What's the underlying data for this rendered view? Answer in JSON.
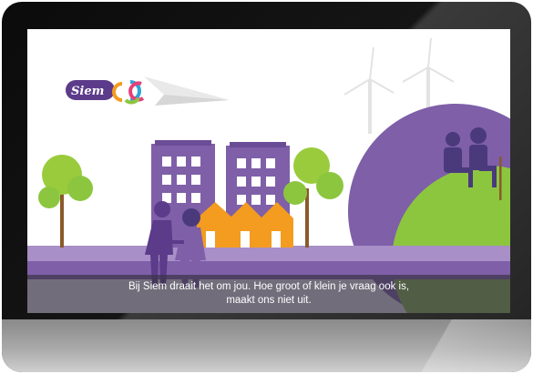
{
  "video": {
    "logo_text": "Siem",
    "subtitle_line1": "Bij Siem draait het om jou. Hoe groot of klein je vraag ook is,",
    "subtitle_line2": "maakt ons niet uit."
  },
  "colors": {
    "purple": "#7e5fa8",
    "dark_purple": "#4a3a7c",
    "green": "#8cc63f",
    "orange": "#f39c1f"
  }
}
